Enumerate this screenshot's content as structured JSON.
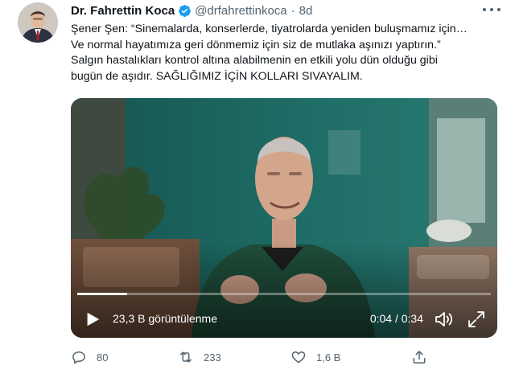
{
  "author": {
    "name": "Dr. Fahrettin Koca",
    "handle": "@drfahrettinkoca",
    "separator": "·",
    "time": "8d",
    "verified_icon": "verified-badge-icon"
  },
  "tweet": {
    "lines": [
      "Şener Şen: “Sinemalarda, konserlerde, tiyatrolarda yeniden buluşmamız için…",
      "Ve normal hayatımıza geri dönmemiz için siz de mutlaka aşınızı yaptırın.”",
      "Salgın hastalıkları kontrol altına alabilmenin en etkili yolu dün olduğu gibi",
      "bugün de aşıdır. SAĞLIĞIMIZ İÇİN KOLLARI SIVAYALIM."
    ]
  },
  "video": {
    "views": "23,3 B görüntülenme",
    "time": "0:04 / 0:34",
    "progress": 0.12,
    "icons": [
      "play-icon",
      "volume-icon",
      "fullscreen-icon"
    ]
  },
  "actions": {
    "replies": "80",
    "retweets": "233",
    "likes": "1,6 B"
  },
  "colors": {
    "text": "#0f1419",
    "secondary": "#536471",
    "verified": "#1d9bf0",
    "video_bg": "#1f5d58"
  }
}
